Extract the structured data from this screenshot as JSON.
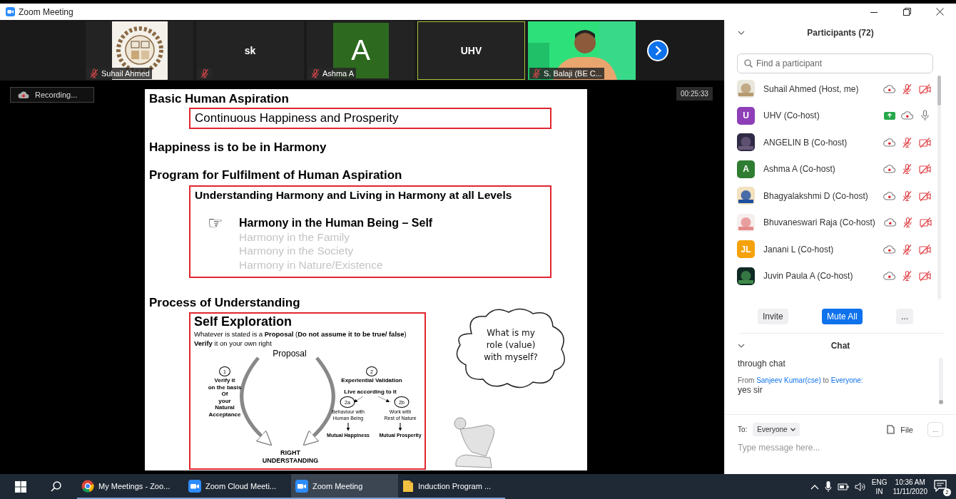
{
  "window": {
    "title": "Zoom Meeting"
  },
  "video_strip": {
    "tiles": [
      {
        "kind": "picture",
        "name": "Suhail Ahmed",
        "muted": true,
        "active_speaker": false
      },
      {
        "kind": "name",
        "display": "sk",
        "muted": true,
        "active_speaker": false
      },
      {
        "kind": "initial",
        "initial": "A",
        "color": "#2d6a1f",
        "name": "Ashma A",
        "muted": true,
        "active_speaker": false
      },
      {
        "kind": "name",
        "display": "UHV",
        "muted": false,
        "active_speaker": true
      },
      {
        "kind": "person",
        "name": "S. Balaji (BE C...",
        "muted": true,
        "active_speaker": false
      }
    ]
  },
  "recording": {
    "label": "Recording..."
  },
  "timer": "00:25:33",
  "slide": {
    "aspiration": {
      "heading": "Basic Human Aspiration",
      "boxed": "Continuous Happiness and Prosperity"
    },
    "happiness": "Happiness is to be in Harmony",
    "program": {
      "heading": "Program for Fulfilment of Human Aspiration",
      "box_title": "Understanding Harmony and Living in Harmony at all Levels",
      "marker": "☞",
      "items": [
        {
          "text": "Harmony in the Human Being – Self",
          "highlighted": true
        },
        {
          "text": "Harmony in  the Family",
          "highlighted": false
        },
        {
          "text": "Harmony in  the Society",
          "highlighted": false
        },
        {
          "text": "Harmony in Nature/Existence",
          "highlighted": false
        }
      ]
    },
    "process": {
      "heading": "Process of Understanding",
      "box_title": "Self Exploration",
      "lines": [
        "Whatever is stated is a **Proposal** (**Do not assume it to be true/ false**)",
        "**Verify** it on your own right"
      ],
      "diagram": {
        "proposal": "Proposal",
        "step_1": "1",
        "verify": "Verify it\non the basis\nOf\nyour\nNatural\nAcceptance",
        "step_2": "2",
        "validation": "Experiential Validation",
        "live": "Live according to it",
        "step_2a": "2a",
        "step_2b": "2b",
        "behaviour": "Behaviour with\nHuman Being",
        "work": "Work with\nRest of Nature",
        "happiness": "Mutual Happiness",
        "prosperity": "Mutual Prosperity",
        "result": "RIGHT\nUNDERSTANDING"
      },
      "thought": "What is my\nrole (value)\nwith myself?"
    }
  },
  "participants": {
    "title": "Participants (72)",
    "search": {
      "placeholder": "Find a participant"
    },
    "rows": [
      {
        "name": "Suhail Ahmed (Host, me)",
        "sharing": false,
        "muted": true,
        "video_off": true
      },
      {
        "name": "UHV (Co-host)",
        "avatar": {
          "kind": "initials",
          "initials": "U",
          "color": "#8e3fb8"
        },
        "sharing": true,
        "muted": false,
        "video_off": false
      },
      {
        "name": "ANGELIN B (Co-host)",
        "sharing": false,
        "muted": true,
        "video_off": true
      },
      {
        "name": "Ashma A (Co-host)",
        "avatar": {
          "kind": "initials",
          "initials": "A",
          "color": "#2e7d32"
        },
        "sharing": false,
        "muted": true,
        "video_off": true
      },
      {
        "name": "Bhagyalakshmi D (Co-host)",
        "sharing": false,
        "muted": true,
        "video_off": true
      },
      {
        "name": "Bhuvaneswari Raja (Co-host)",
        "sharing": false,
        "muted": true,
        "video_off": true
      },
      {
        "name": "Janani L (Co-host)",
        "avatar": {
          "kind": "initials",
          "initials": "JL",
          "color": "#f5a20a"
        },
        "sharing": false,
        "muted": true,
        "video_off": true
      },
      {
        "name": "Juvin Paula A (Co-host)",
        "sharing": false,
        "muted": true,
        "video_off": true
      }
    ],
    "buttons": [
      {
        "label": "Invite",
        "kind": "plain"
      },
      {
        "label": "Mute All",
        "kind": "primary"
      },
      {
        "label": "...",
        "kind": "plain"
      }
    ]
  },
  "chat": {
    "title": "Chat",
    "messages": [
      {
        "kind": "text",
        "text": "through chat"
      },
      {
        "kind": "header",
        "from_label": "From",
        "from": "Sanjeev Kumar(cse)",
        "to_label": "to",
        "to": "Everyone:"
      },
      {
        "kind": "text",
        "text": "yes sir"
      }
    ],
    "to_label": "To:",
    "recipient": "Everyone",
    "file": "File",
    "more": "...",
    "placeholder": "Type message here..."
  },
  "taskbar": {
    "apps": [
      {
        "label": "My Meetings - Zoo...",
        "kind": "browser",
        "selected": false
      },
      {
        "label": "Zoom Cloud Meeti...",
        "kind": "video",
        "selected": false
      },
      {
        "label": "Zoom Meeting",
        "kind": "video",
        "selected": true
      },
      {
        "label": "Induction Program ...",
        "kind": "document",
        "selected": false
      }
    ],
    "language": "ENG",
    "region": "IN",
    "time": "10:36 AM",
    "date": "11/11/2020",
    "notifications": "2"
  }
}
